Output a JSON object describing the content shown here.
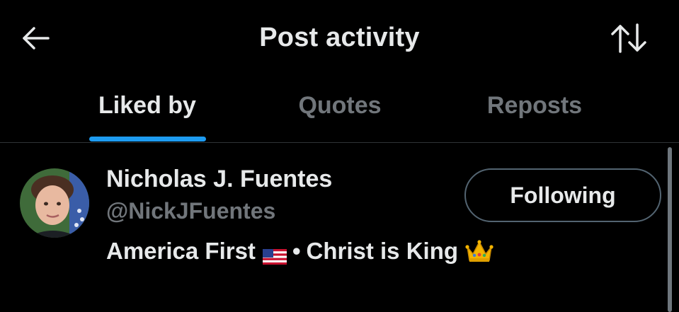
{
  "header": {
    "title": "Post activity",
    "back_icon": "arrow-left-icon",
    "sort_icon": "sort-arrows-icon"
  },
  "tabs": [
    {
      "label": "Liked by",
      "active": true
    },
    {
      "label": "Quotes",
      "active": false
    },
    {
      "label": "Reposts",
      "active": false
    }
  ],
  "user": {
    "name": "Nicholas J. Fuentes",
    "handle": "@NickJFuentes",
    "follow_label": "Following",
    "bio_part1": "America First",
    "bio_separator": "•",
    "bio_part2": "Christ is King",
    "bio_icons": [
      "us-flag-icon",
      "crown-icon"
    ]
  },
  "colors": {
    "background": "#000000",
    "text_primary": "#e7e9ea",
    "text_secondary": "#71767b",
    "accent": "#1d9bf0",
    "border": "#2f3336"
  }
}
